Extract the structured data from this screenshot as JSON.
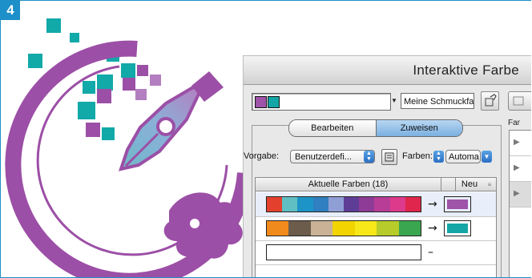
{
  "step": {
    "number": "4"
  },
  "dialog": {
    "title": "Interaktive Farbe",
    "swatch_name": "Meine Schmuckfarb",
    "right_label": "Far",
    "tabs": {
      "edit": "Bearbeiten",
      "assign": "Zuweisen",
      "active": "Zuweisen"
    },
    "preset": {
      "label": "Vorgabe:",
      "value": "Benutzerdefi..."
    },
    "colors": {
      "label": "Farben:",
      "value": "Automa"
    },
    "table": {
      "col_current": "Aktuelle Farben (18)",
      "col_new": "Neu",
      "rows": [
        {
          "current": [
            "#e4402e",
            "#5fbfc3",
            "#1d94c7",
            "#2f7fc1",
            "#8f9fd6",
            "#5e3d97",
            "#8d3b96",
            "#b73d97",
            "#dd3a8c",
            "#e0264c"
          ],
          "arrow": "→",
          "new": "#9e54a8"
        },
        {
          "current": [
            "#f08a1c",
            "#6b5c4b",
            "#c9b296",
            "#f2d400",
            "#f7e81a",
            "#b7cc2a",
            "#3aa64f"
          ],
          "arrow": "→",
          "new": "#14a6a6"
        },
        {
          "current": [
            "#ffffff"
          ],
          "arrow": "–",
          "new": ""
        }
      ]
    }
  },
  "colors": {
    "accent_blue": "#1d8fc9",
    "logo_purple": "#9c4fa6",
    "logo_teal": "#12a9a9"
  }
}
